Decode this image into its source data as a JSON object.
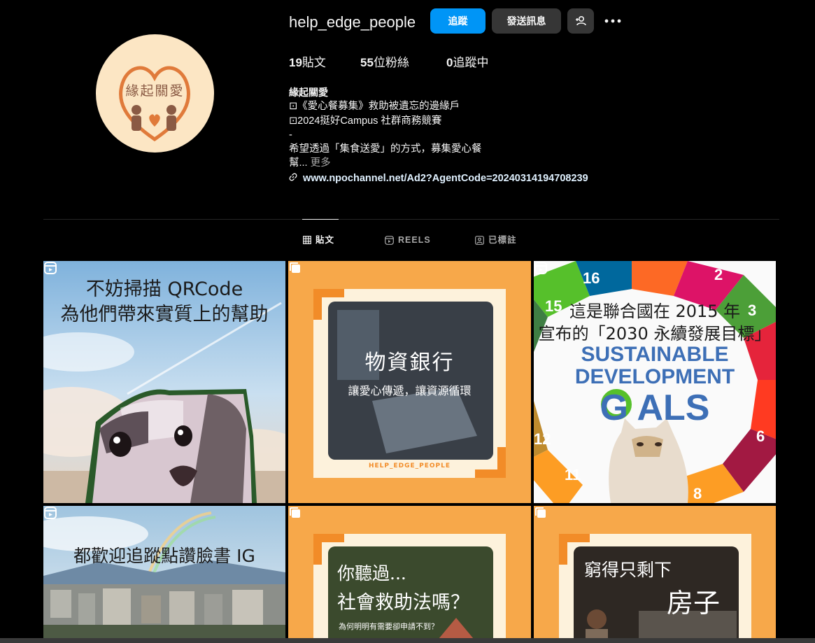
{
  "profile": {
    "username": "help_edge_people",
    "follow_label": "追蹤",
    "message_label": "發送訊息",
    "suggest_icon": "person-plus-icon",
    "more_icon": "more-dots-icon",
    "avatar_text": "緣起關愛"
  },
  "stats": {
    "posts_count": "19",
    "posts_label": "貼文",
    "followers_count": "55",
    "followers_label": "位粉絲",
    "following_count": "0",
    "following_label": "追蹤中"
  },
  "bio": {
    "name": "緣起關愛",
    "line1": "⊡《愛心餐募集》救助被遺忘的邊緣戶",
    "line2": "⊡2024挺好Campus 社群商務競賽",
    "line3": "-",
    "line4": "希望透過「集食送愛」的方式，募集愛心餐",
    "line5": "幫...",
    "more_label": "更多",
    "link": "www.npochannel.net/Ad2?AgentCode=20240314194708239"
  },
  "tabs": {
    "posts": "貼文",
    "reels": "REELS",
    "tagged": "已標註"
  },
  "tiles": {
    "t1": {
      "line1": "不妨掃描 QRCode",
      "line2": "為他們帶來實質上的幫助"
    },
    "t2": {
      "title": "物資銀行",
      "subtitle": "讓愛心傳遞，讓資源循環",
      "footer": "HELP_EDGE_PEOPLE"
    },
    "t3": {
      "line1": "這是聯合國在 2015 年",
      "line2": "宣布的「2030 永續發展目標」",
      "logo1": "SUSTAINABLE",
      "logo2": "DEVELOPMENT",
      "logo3": "G   ALS"
    },
    "t4": {
      "line1": "都歡迎追蹤點讚臉書 IG"
    },
    "t5": {
      "title1": "你聽過...",
      "title2": "社會救助法嗎？",
      "subtitle": "為何明明有需要卻申請不到？"
    },
    "t6": {
      "title1": "窮得只剩下",
      "title2": "房子"
    }
  },
  "colors": {
    "accent": "#0095f6",
    "orange": "#f7a84a",
    "cream": "#fdf2dc"
  }
}
